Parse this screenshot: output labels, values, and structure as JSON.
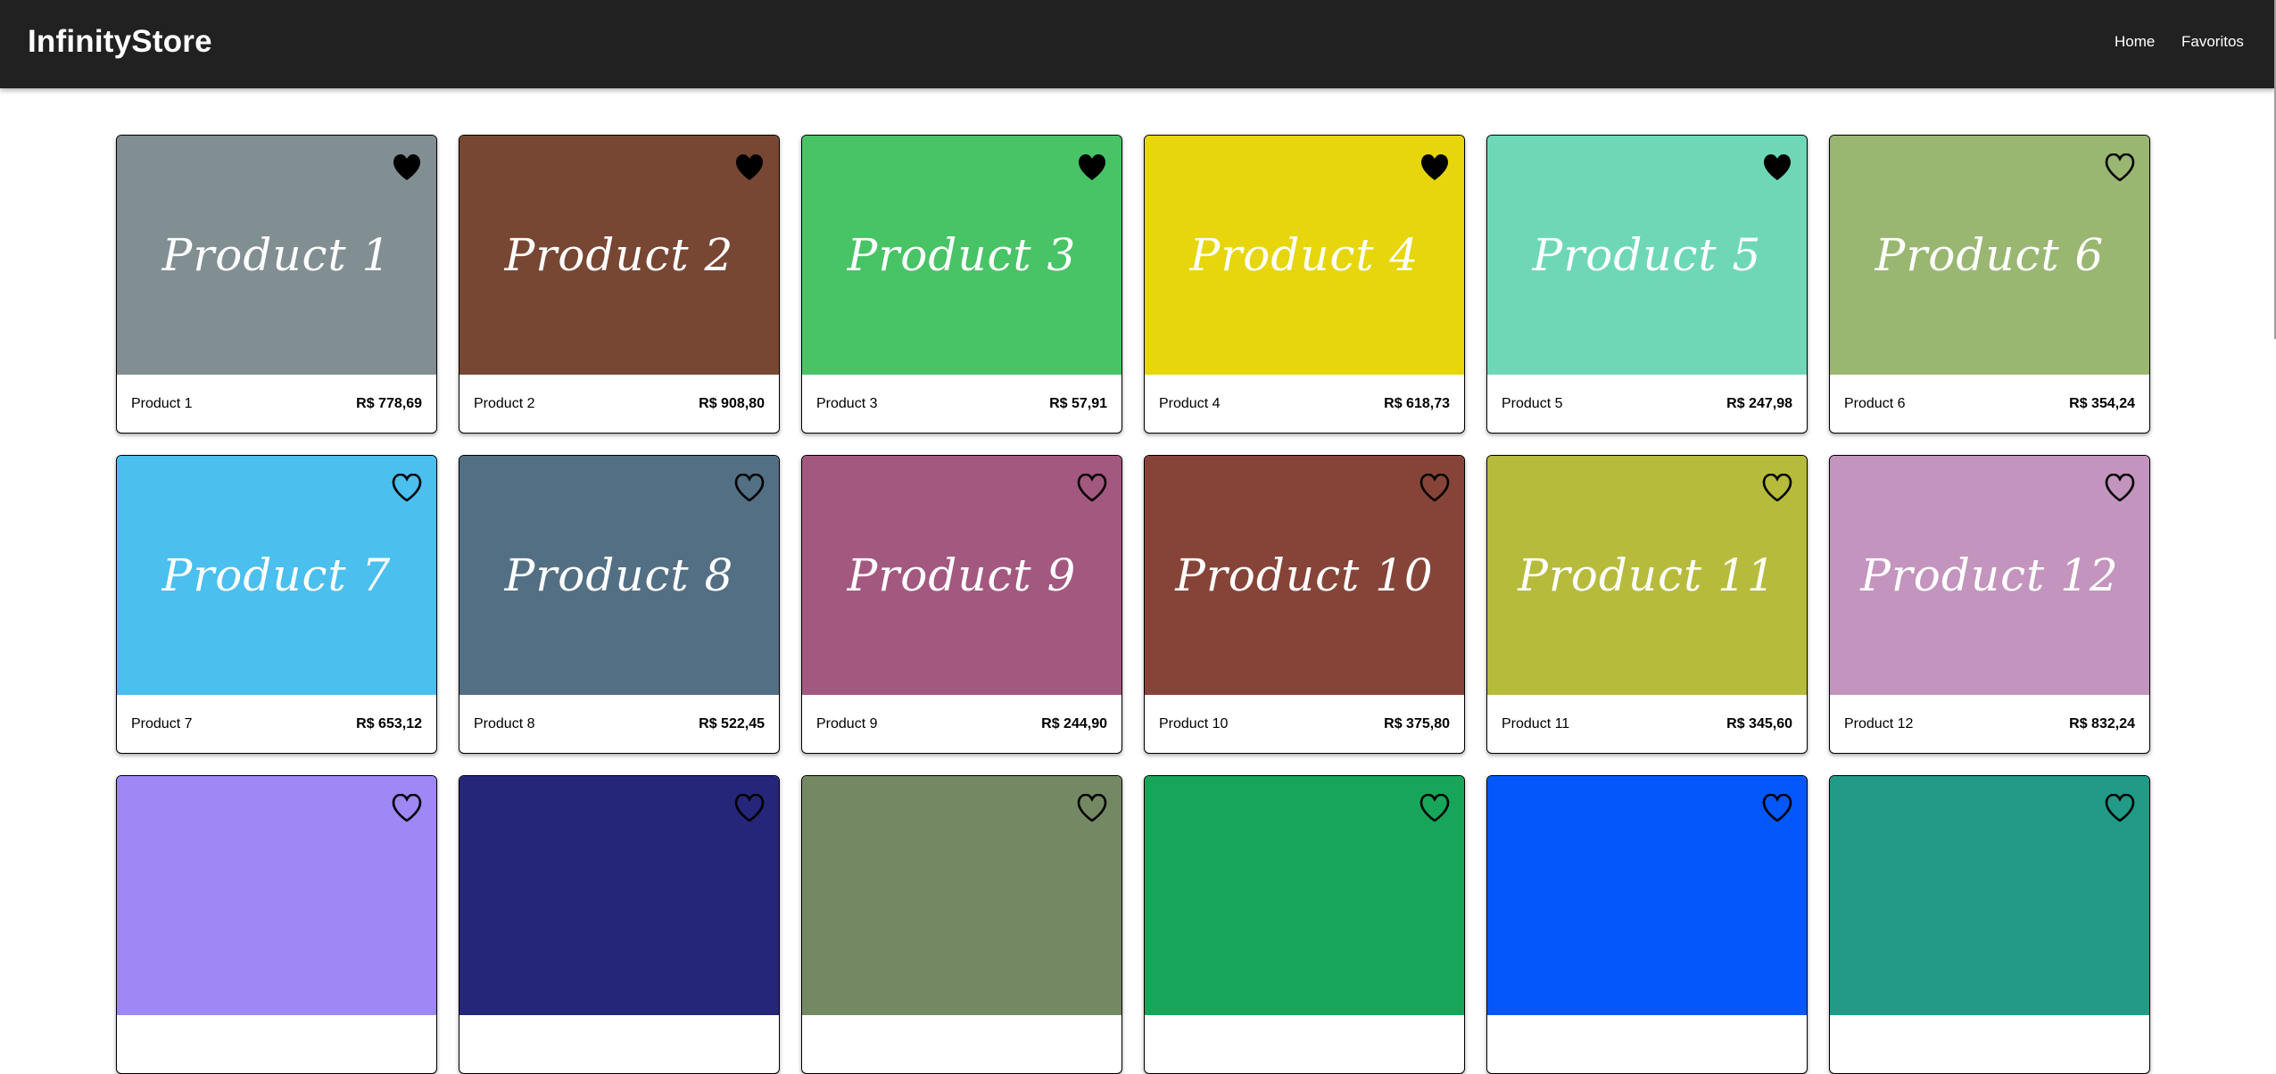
{
  "header": {
    "brand": "InfinityStore",
    "nav": [
      {
        "label": "Home"
      },
      {
        "label": "Favoritos"
      }
    ]
  },
  "products": [
    {
      "image_label": "Product 1",
      "name": "Product 1",
      "price": "R$ 778,69",
      "color": "#818e92",
      "favorite": true
    },
    {
      "image_label": "Product 2",
      "name": "Product 2",
      "price": "R$ 908,80",
      "color": "#784734",
      "favorite": true
    },
    {
      "image_label": "Product 3",
      "name": "Product 3",
      "price": "R$ 57,91",
      "color": "#48c366",
      "favorite": true
    },
    {
      "image_label": "Product 4",
      "name": "Product 4",
      "price": "R$ 618,73",
      "color": "#e6d60b",
      "favorite": true
    },
    {
      "image_label": "Product 5",
      "name": "Product 5",
      "price": "R$ 247,98",
      "color": "#6ed8b6",
      "favorite": true
    },
    {
      "image_label": "Product 6",
      "name": "Product 6",
      "price": "R$ 354,24",
      "color": "#9ab772",
      "favorite": false
    },
    {
      "image_label": "Product 7",
      "name": "Product 7",
      "price": "R$ 653,12",
      "color": "#4bbfed",
      "favorite": false
    },
    {
      "image_label": "Product 8",
      "name": "Product 8",
      "price": "R$ 522,45",
      "color": "#536f83",
      "favorite": false
    },
    {
      "image_label": "Product 9",
      "name": "Product 9",
      "price": "R$ 244,90",
      "color": "#a35880",
      "favorite": false
    },
    {
      "image_label": "Product 10",
      "name": "Product 10",
      "price": "R$ 375,80",
      "color": "#864438",
      "favorite": false
    },
    {
      "image_label": "Product 11",
      "name": "Product 11",
      "price": "R$ 345,60",
      "color": "#b6bb3c",
      "favorite": false
    },
    {
      "image_label": "Product 12",
      "name": "Product 12",
      "price": "R$ 832,24",
      "color": "#c394bd",
      "favorite": false
    },
    {
      "color": "#9f87f5",
      "favorite": false
    },
    {
      "color": "#25267a",
      "favorite": false
    },
    {
      "color": "#748864",
      "favorite": false
    },
    {
      "color": "#17a659",
      "favorite": false
    },
    {
      "color": "#0457fb",
      "favorite": false
    },
    {
      "color": "#219a87",
      "favorite": false
    }
  ]
}
